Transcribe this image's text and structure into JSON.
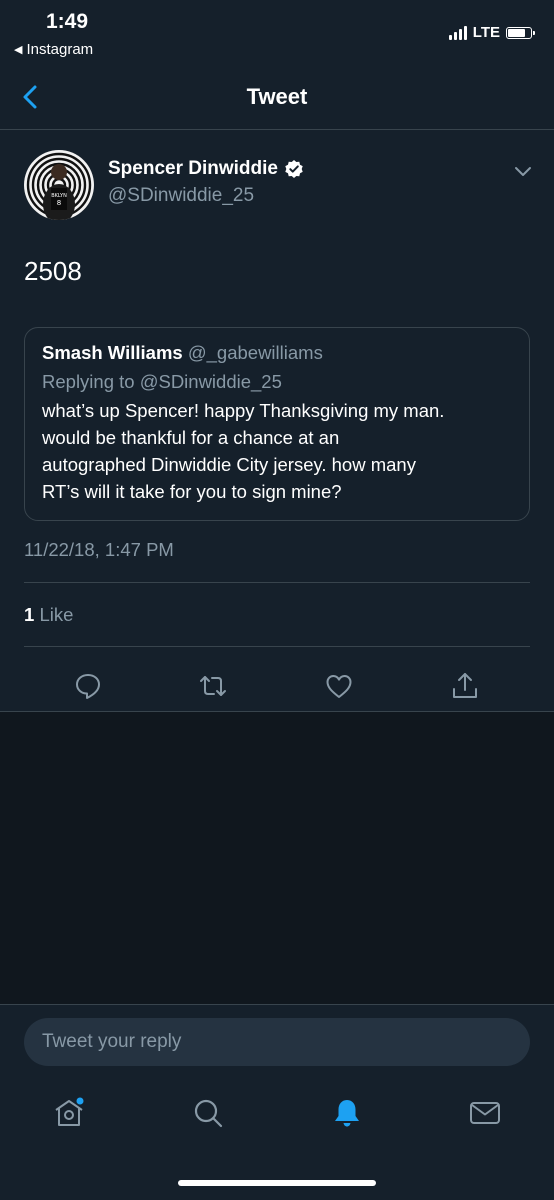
{
  "status": {
    "time": "1:49",
    "back_app": "Instagram",
    "network": "LTE"
  },
  "nav": {
    "title": "Tweet"
  },
  "tweet": {
    "author_name": "Spencer Dinwiddie",
    "author_handle": "@SDinwiddie_25",
    "text": "2508",
    "timestamp": "11/22/18, 1:47 PM",
    "likes_count": "1",
    "likes_label": "Like"
  },
  "quote": {
    "name": "Smash Williams",
    "handle": "@_gabewilliams",
    "replying_to": "Replying to @SDinwiddie_25",
    "text_lines": [
      "what’s up Spencer! happy Thanksgiving my man.",
      "would be thankful for a chance at an",
      "autographed Dinwiddie City jersey. how many",
      "RT’s will it take for you to sign mine?"
    ]
  },
  "reply": {
    "placeholder": "Tweet your reply"
  },
  "icons": {
    "actions": [
      "reply-icon",
      "retweet-icon",
      "like-icon",
      "share-icon"
    ],
    "tabs": [
      "home-icon",
      "search-icon",
      "notifications-icon",
      "messages-icon"
    ]
  },
  "colors": {
    "background": "#15202b",
    "accent": "#1da1f2",
    "muted": "#8899a6",
    "border": "#38444d"
  }
}
